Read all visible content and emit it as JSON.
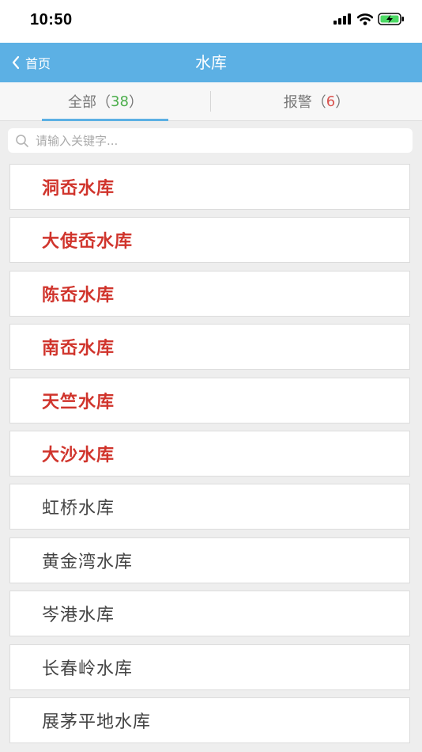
{
  "status_bar": {
    "time": "10:50",
    "icons": [
      "signal-icon",
      "wifi-icon",
      "battery-charging-icon"
    ]
  },
  "nav": {
    "back_label": "首页",
    "title": "水库",
    "color": "#5cb0e4"
  },
  "tabs": [
    {
      "label": "全部",
      "count": "38",
      "active": true
    },
    {
      "label": "报警",
      "count": "6",
      "active": false
    }
  ],
  "search": {
    "placeholder": "请输入关键字..."
  },
  "reservoirs": [
    {
      "name": "洞岙水库",
      "alarm": true
    },
    {
      "name": "大使岙水库",
      "alarm": true
    },
    {
      "name": "陈岙水库",
      "alarm": true
    },
    {
      "name": "南岙水库",
      "alarm": true
    },
    {
      "name": "天竺水库",
      "alarm": true
    },
    {
      "name": "大沙水库",
      "alarm": true
    },
    {
      "name": "虹桥水库",
      "alarm": false
    },
    {
      "name": "黄金湾水库",
      "alarm": false
    },
    {
      "name": "岑港水库",
      "alarm": false
    },
    {
      "name": "长春岭水库",
      "alarm": false
    },
    {
      "name": "展茅平地水库",
      "alarm": false
    }
  ],
  "colors": {
    "alarm_text": "#d0342c",
    "normal_text": "#444444",
    "count_all": "#4cae4c",
    "count_alarm": "#d9534f"
  }
}
